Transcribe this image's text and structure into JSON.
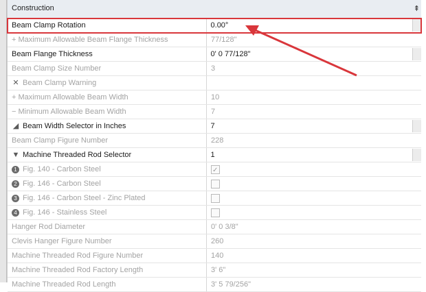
{
  "panel": {
    "header_title": "Construction",
    "collapse_label": "⇞"
  },
  "rows": [
    {
      "name": "Beam Clamp Rotation",
      "value": "0.00°"
    },
    {
      "name": "+ Maximum Allowable Beam Flange Thickness",
      "value": "77/128\""
    },
    {
      "name": "Beam Flange Thickness",
      "value": "0' 0 77/128\""
    },
    {
      "name": "Beam Clamp Size Number",
      "value": "3"
    },
    {
      "name": "Beam Clamp Warning",
      "value": ""
    },
    {
      "name": "+ Maximum Allowable Beam Width",
      "value": "10"
    },
    {
      "name": "− Minimum Allowable Beam Width",
      "value": "7"
    },
    {
      "name": "Beam Width Selector in Inches",
      "value": "7"
    },
    {
      "name": "Beam Clamp Figure Number",
      "value": "228"
    },
    {
      "name": "Machine Threaded Rod Selector",
      "value": "1"
    },
    {
      "name": "Fig. 140 - Carbon Steel",
      "value": "",
      "badge": "1"
    },
    {
      "name": "Fig. 146 - Carbon Steel",
      "value": "",
      "badge": "2"
    },
    {
      "name": "Fig. 146 - Carbon Steel - Zinc Plated",
      "value": "",
      "badge": "3"
    },
    {
      "name": "Fig. 146 - Stainless Steel",
      "value": "",
      "badge": "4"
    },
    {
      "name": "Hanger Rod Diameter",
      "value": "0' 0 3/8\""
    },
    {
      "name": "Clevis Hanger Figure Number",
      "value": "260"
    },
    {
      "name": "Machine Threaded Rod Figure Number",
      "value": "140"
    },
    {
      "name": "Machine Threaded Rod Factory Length",
      "value": "3' 6\""
    },
    {
      "name": "Machine Threaded Rod Length",
      "value": "3' 5 79/256\""
    }
  ],
  "glyphs": {
    "warning": "✕",
    "triangle_left": "◢",
    "triangle_down": "▼"
  },
  "colors": {
    "highlight": "#d9363b",
    "arrow": "#d9363b",
    "header_bg": "#e9edf2"
  }
}
